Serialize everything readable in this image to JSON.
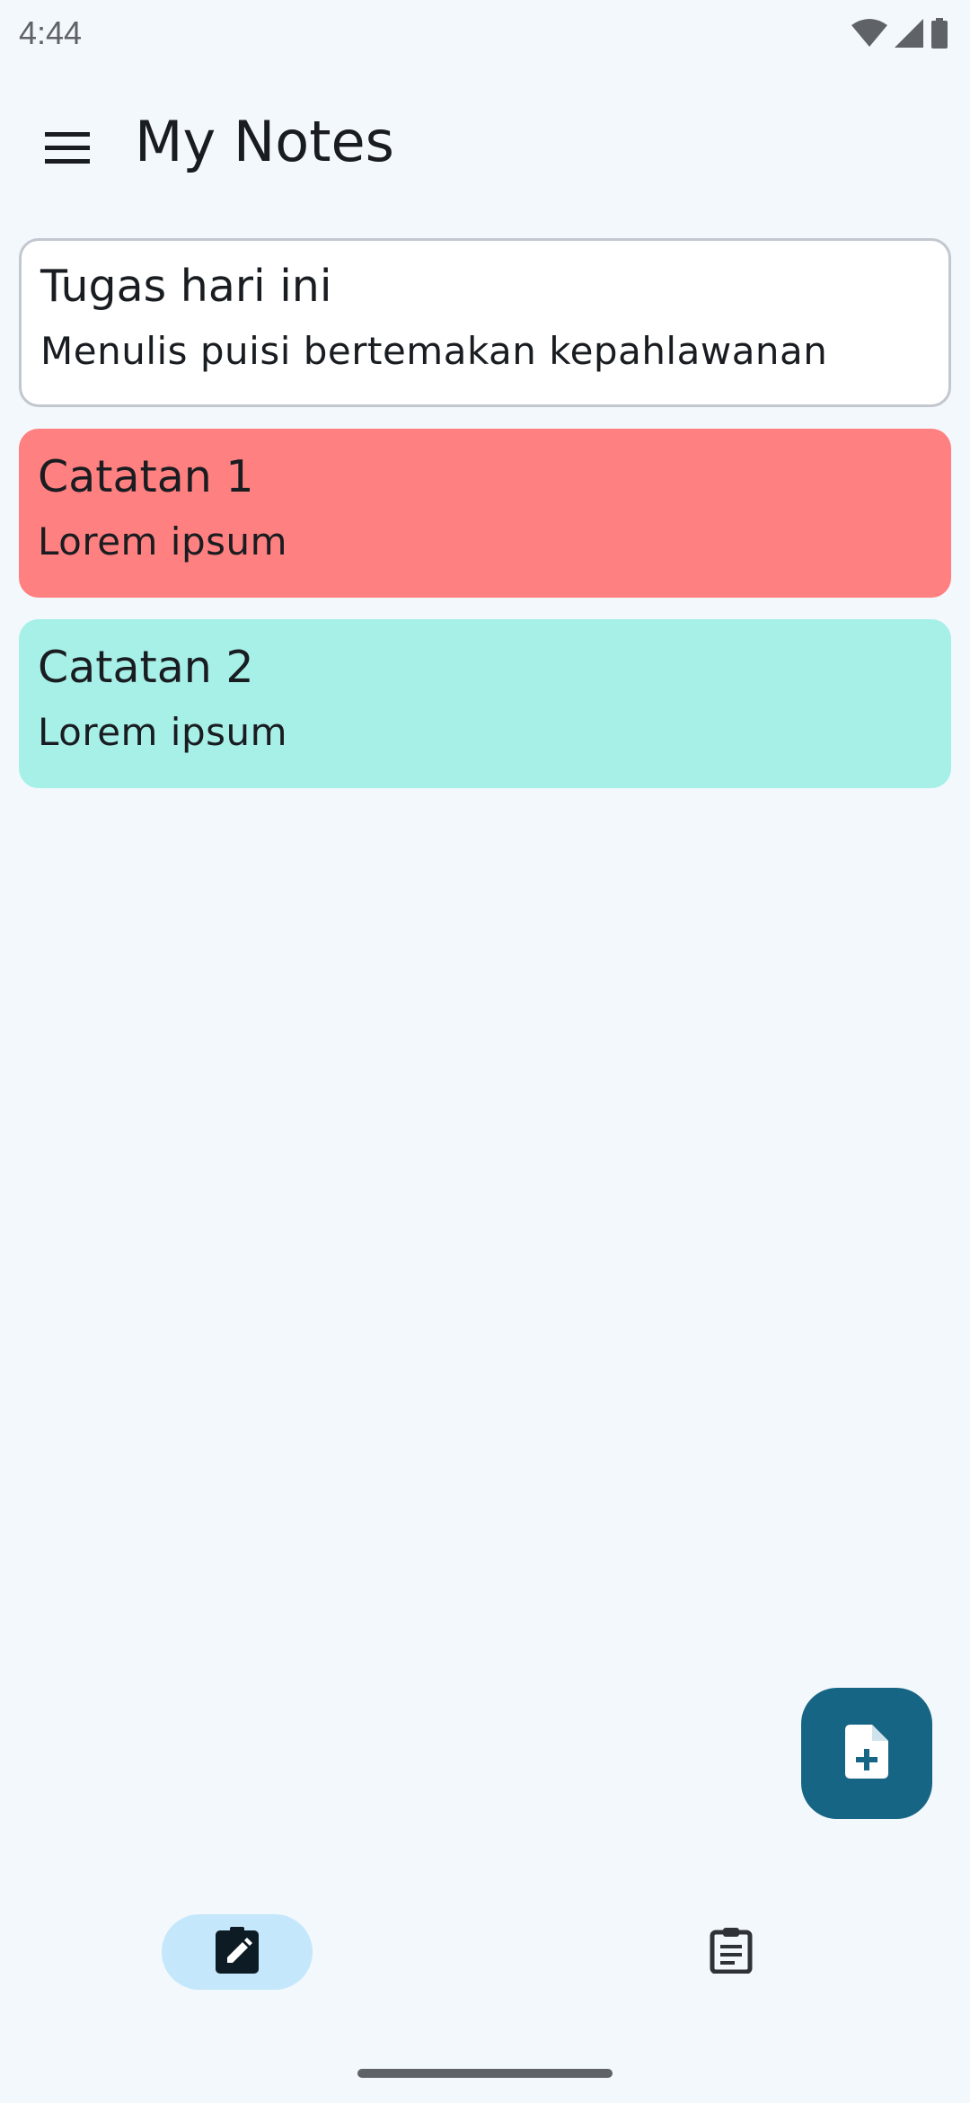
{
  "status_bar": {
    "time": "4:44",
    "icons": [
      "wifi-icon",
      "cell-signal-icon",
      "battery-icon"
    ]
  },
  "app_bar": {
    "menu_icon": "hamburger-menu-icon",
    "title": "My Notes"
  },
  "notes": [
    {
      "title": "Tugas hari ini",
      "body": "Menulis puisi bertemakan kepahlawanan",
      "color": "#ffffff",
      "style": "outlined"
    },
    {
      "title": "Catatan 1",
      "body": "Lorem ipsum",
      "color": "#ff8080",
      "style": "filled"
    },
    {
      "title": "Catatan 2",
      "body": "Lorem ipsum",
      "color": "#a7f0e8",
      "style": "filled"
    }
  ],
  "fab": {
    "icon": "note-add-icon",
    "color": "#176584"
  },
  "bottom_nav": {
    "items": [
      {
        "icon": "edit-note-icon",
        "selected": true
      },
      {
        "icon": "clipboard-list-icon",
        "selected": false
      }
    ],
    "active_indicator_color": "#c4e7fb"
  },
  "colors": {
    "background": "#f3f8fd",
    "on_surface": "#191c20",
    "outline": "#c3c7cf"
  }
}
